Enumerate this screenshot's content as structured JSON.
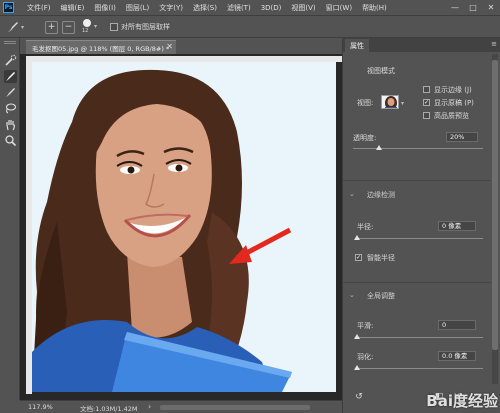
{
  "app": {
    "logo": "Ps",
    "menu": [
      "文件(F)",
      "编辑(E)",
      "图像(I)",
      "图层(L)",
      "文字(Y)",
      "选择(S)",
      "滤镜(T)",
      "3D(D)",
      "视图(V)",
      "窗口(W)",
      "帮助(H)"
    ],
    "window_controls": [
      "—",
      "□",
      "✕"
    ]
  },
  "options": {
    "brush_size": "12",
    "sample_all_label": "对所有图层取样",
    "sample_all_checked": false
  },
  "tools": [
    "quick-selection",
    "refine-edge-brush",
    "brush",
    "lasso",
    "hand",
    "zoom"
  ],
  "document": {
    "tab_label": "毛发抠图05.jpg @ 118% (图层 0, RGB/8#) *",
    "close": "✕",
    "zoom": "117.9%",
    "doc_info": "文档:1.03M/1.42M",
    "status_arrow": "›"
  },
  "panel": {
    "tab": "属性",
    "menu_icon": "≡",
    "view_mode_title": "视图模式",
    "view_label": "视图:",
    "show_edge": "显示边缘 (J)",
    "show_edge_checked": false,
    "show_original": "显示原稿 (P)",
    "show_original_checked": true,
    "hq_preview": "高品质预览",
    "hq_preview_checked": false,
    "opacity_label": "透明度:",
    "opacity_value": "20%",
    "opacity_fraction": 0.2,
    "edge_detection_title": "边缘检测",
    "radius_label": "半径:",
    "radius_value": "0 像素",
    "smart_radius_label": "智能半径",
    "smart_radius_checked": true,
    "global_refine_title": "全局调整",
    "smooth_label": "平滑:",
    "smooth_value": "0",
    "feather_label": "羽化:",
    "feather_value": "0.0 像素"
  },
  "watermark": "Bai度经验"
}
